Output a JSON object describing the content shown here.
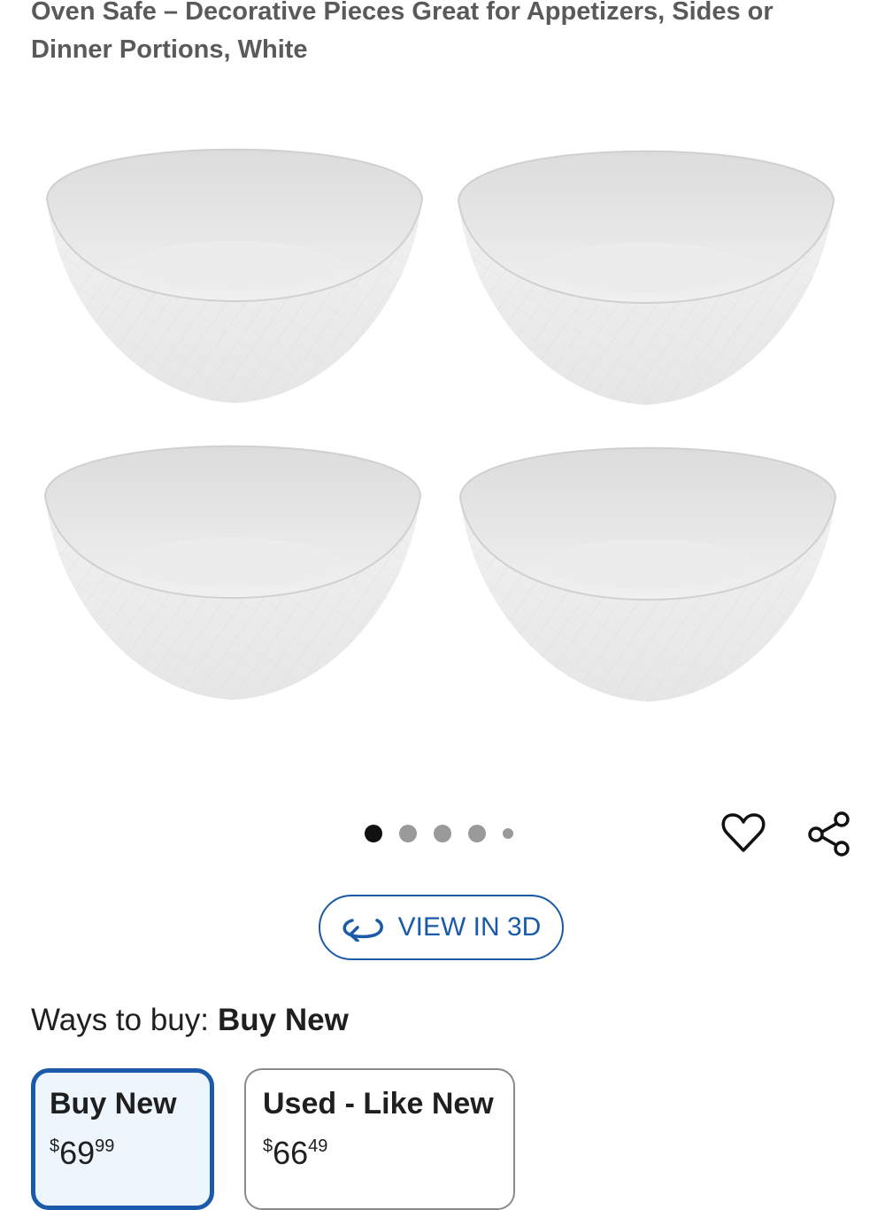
{
  "product": {
    "title": "Oven Safe – Decorative Pieces Great for Appetizers, Sides or Dinner Portions, White"
  },
  "gallery": {
    "image_alt": "Set of four white bowls with crosshatch texture",
    "dot_count": 5,
    "active_dot": 0
  },
  "actions": {
    "favorite_icon": "heart-icon",
    "share_icon": "share-icon",
    "view_3d_label": "VIEW IN 3D",
    "view_3d_icon": "rotate-3d-icon"
  },
  "ways_to_buy": {
    "label": "Ways to buy:",
    "selected": "Buy New",
    "options": [
      {
        "label": "Buy New",
        "currency": "$",
        "dollars": "69",
        "cents": "99"
      },
      {
        "label": "Used - Like New",
        "currency": "$",
        "dollars": "66",
        "cents": "49"
      }
    ]
  },
  "colors": {
    "accent": "#1a5aa8",
    "selected_bg": "#eef6fd",
    "title_text": "#5a5a5a"
  }
}
